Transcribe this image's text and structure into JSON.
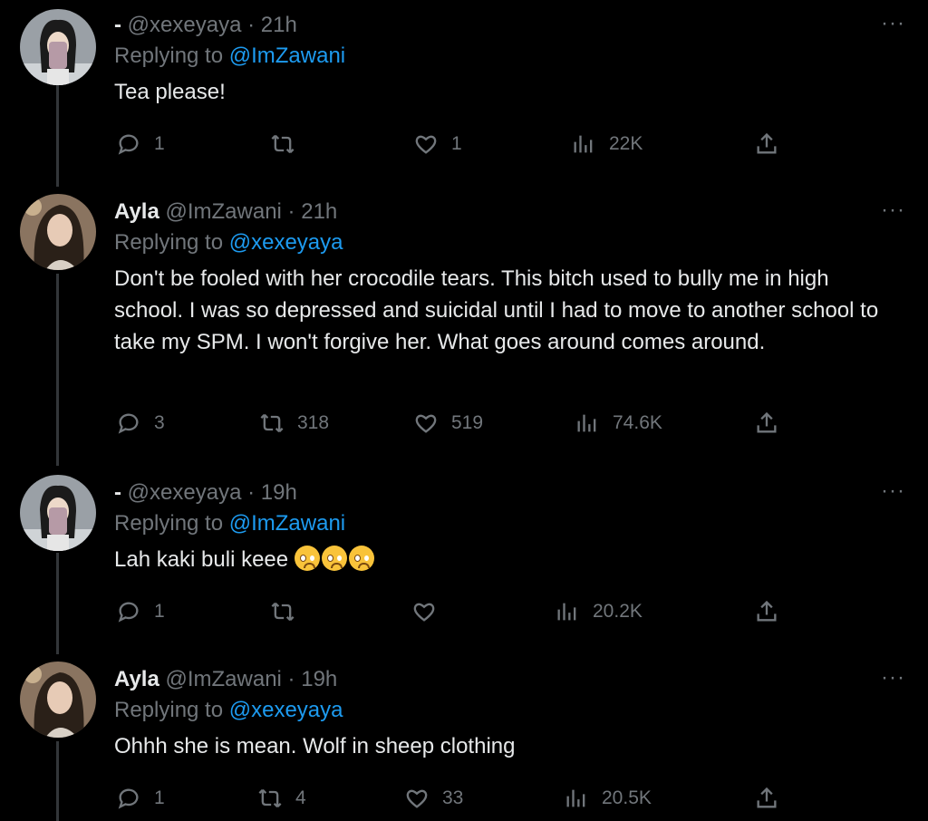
{
  "tweets": [
    {
      "name": "-",
      "handle": "@xexeyaya",
      "sep": "·",
      "time": "21h",
      "replying_label": "Replying to",
      "replying_to": "@ImZawani",
      "body": "Tea please!",
      "replies": "1",
      "retweets": "",
      "likes": "1",
      "views": "22K",
      "avatar": "selfie-woman-phone-case"
    },
    {
      "name": "Ayla",
      "handle": "@ImZawani",
      "sep": "·",
      "time": "21h",
      "replying_label": "Replying to",
      "replying_to": "@xexeyaya",
      "body": "Don't be fooled with her crocodile tears. This bitch used to bully me in high school. I was so depressed and suicidal until I had to move to another school to take my SPM. I won't forgive her. What goes around comes around.",
      "replies": "3",
      "retweets": "318",
      "likes": "519",
      "views": "74.6K",
      "avatar": "woman-long-hair"
    },
    {
      "name": "-",
      "handle": "@xexeyaya",
      "sep": "·",
      "time": "19h",
      "replying_label": "Replying to",
      "replying_to": "@ImZawani",
      "body": "Lah kaki buli keee",
      "emoji": "pleading-face-emoji",
      "replies": "1",
      "retweets": "",
      "likes": "",
      "views": "20.2K",
      "avatar": "selfie-woman-phone-case"
    },
    {
      "name": "Ayla",
      "handle": "@ImZawani",
      "sep": "·",
      "time": "19h",
      "replying_label": "Replying to",
      "replying_to": "@xexeyaya",
      "body": "Ohhh she is mean. Wolf in sheep clothing",
      "replies": "1",
      "retweets": "4",
      "likes": "33",
      "views": "20.5K",
      "avatar": "woman-long-hair"
    }
  ],
  "more_label": "···",
  "colors": {
    "background": "#000000",
    "text": "#e7e9ea",
    "muted": "#71767b",
    "accent": "#1d9bf0"
  }
}
